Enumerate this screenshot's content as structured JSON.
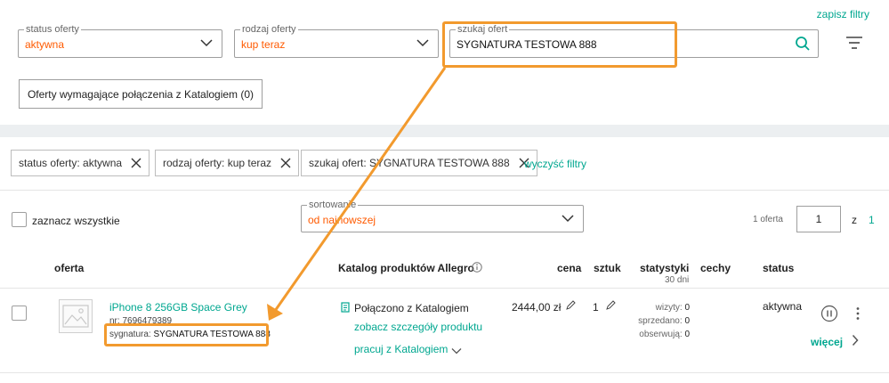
{
  "filters": {
    "save_label": "zapisz filtry",
    "status": {
      "legend": "status oferty",
      "value": "aktywna"
    },
    "type": {
      "legend": "rodzaj oferty",
      "value": "kup teraz"
    },
    "search": {
      "legend": "szukaj ofert",
      "value": "SYGNATURA TESTOWA 888"
    }
  },
  "catalog_button": "Oferty wymagające połączenia z Katalogiem (0)",
  "chips": {
    "status": "status oferty: aktywna",
    "type": "rodzaj oferty: kup teraz",
    "search": "szukaj ofert: SYGNATURA TESTOWA 888",
    "clear": "wyczyść filtry"
  },
  "list": {
    "select_all": "zaznacz wszystkie",
    "sort": {
      "legend": "sortowanie",
      "value": "od najnowszej"
    },
    "pager": {
      "count": "1 oferta",
      "page": "1",
      "of": "z",
      "total": "1"
    }
  },
  "columns": {
    "offer": "oferta",
    "catalog": "Katalog produktów Allegro",
    "price": "cena",
    "qty": "sztuk",
    "stats": "statystyki",
    "stats_sub": "30 dni",
    "features": "cechy",
    "status": "status"
  },
  "offer": {
    "title": "iPhone 8 256GB Space Grey",
    "nr_label": "nr:",
    "nr": "7696479389",
    "signature_label": "sygnatura:",
    "signature": "SYGNATURA TESTOWA 888",
    "catalog_status": "Połączono z Katalogiem",
    "catalog_details": "zobacz szczegóły produktu",
    "catalog_work": "pracuj z Katalogiem",
    "price": "2444,00 zł",
    "qty": "1",
    "stats": {
      "visits_label": "wizyty:",
      "visits": "0",
      "sold_label": "sprzedano:",
      "sold": "0",
      "watch_label": "obserwują:",
      "watch": "0"
    },
    "status": "aktywna",
    "more": "więcej"
  },
  "colors": {
    "accent": "#00a790",
    "orange": "#ff5a00",
    "highlight": "#f29a2e"
  }
}
